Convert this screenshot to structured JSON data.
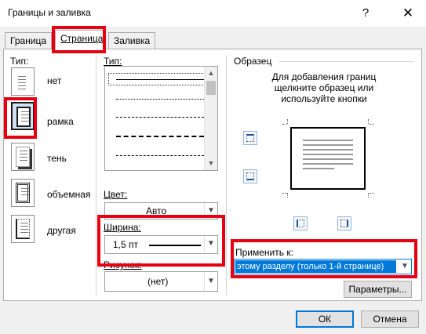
{
  "window": {
    "title": "Границы и заливка",
    "help_label": "?",
    "close_label": "✕"
  },
  "tabs": [
    {
      "label": "Граница"
    },
    {
      "label": "Страница"
    },
    {
      "label": "Заливка"
    }
  ],
  "settings": {
    "header": "Тип:",
    "items": [
      {
        "label": "нет"
      },
      {
        "label": "рамка"
      },
      {
        "label": "тень"
      },
      {
        "label": "объемная"
      },
      {
        "label": "другая"
      }
    ]
  },
  "style": {
    "header": "Тип:",
    "color_label": "Цвет:",
    "color_value": "Авто",
    "width_label": "Ширина:",
    "width_value": "1,5 пт",
    "art_label": "Рисунок:",
    "art_value": "(нет)"
  },
  "preview": {
    "header": "Образец",
    "instructions": [
      "Для добавления границ",
      "щелкните образец или",
      "используйте кнопки"
    ]
  },
  "apply": {
    "label": "Применить к:",
    "value": "этому разделу (только 1-й странице)",
    "options_button": "Параметры..."
  },
  "footer": {
    "ok": "ОК",
    "cancel": "Отмена"
  },
  "colors": {
    "highlight_red": "#e60012",
    "selection_blue": "#0078d7"
  }
}
